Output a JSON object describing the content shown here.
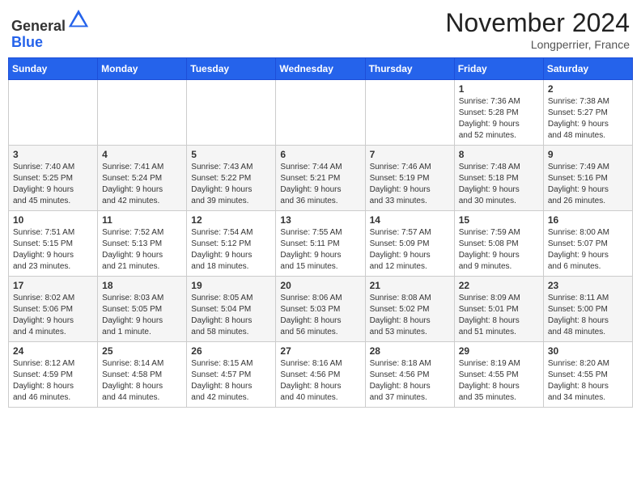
{
  "header": {
    "logo_line1": "General",
    "logo_line2": "Blue",
    "month_title": "November 2024",
    "location": "Longperrier, France"
  },
  "weekdays": [
    "Sunday",
    "Monday",
    "Tuesday",
    "Wednesday",
    "Thursday",
    "Friday",
    "Saturday"
  ],
  "weeks": [
    [
      {
        "day": "",
        "info": ""
      },
      {
        "day": "",
        "info": ""
      },
      {
        "day": "",
        "info": ""
      },
      {
        "day": "",
        "info": ""
      },
      {
        "day": "",
        "info": ""
      },
      {
        "day": "1",
        "info": "Sunrise: 7:36 AM\nSunset: 5:28 PM\nDaylight: 9 hours\nand 52 minutes."
      },
      {
        "day": "2",
        "info": "Sunrise: 7:38 AM\nSunset: 5:27 PM\nDaylight: 9 hours\nand 48 minutes."
      }
    ],
    [
      {
        "day": "3",
        "info": "Sunrise: 7:40 AM\nSunset: 5:25 PM\nDaylight: 9 hours\nand 45 minutes."
      },
      {
        "day": "4",
        "info": "Sunrise: 7:41 AM\nSunset: 5:24 PM\nDaylight: 9 hours\nand 42 minutes."
      },
      {
        "day": "5",
        "info": "Sunrise: 7:43 AM\nSunset: 5:22 PM\nDaylight: 9 hours\nand 39 minutes."
      },
      {
        "day": "6",
        "info": "Sunrise: 7:44 AM\nSunset: 5:21 PM\nDaylight: 9 hours\nand 36 minutes."
      },
      {
        "day": "7",
        "info": "Sunrise: 7:46 AM\nSunset: 5:19 PM\nDaylight: 9 hours\nand 33 minutes."
      },
      {
        "day": "8",
        "info": "Sunrise: 7:48 AM\nSunset: 5:18 PM\nDaylight: 9 hours\nand 30 minutes."
      },
      {
        "day": "9",
        "info": "Sunrise: 7:49 AM\nSunset: 5:16 PM\nDaylight: 9 hours\nand 26 minutes."
      }
    ],
    [
      {
        "day": "10",
        "info": "Sunrise: 7:51 AM\nSunset: 5:15 PM\nDaylight: 9 hours\nand 23 minutes."
      },
      {
        "day": "11",
        "info": "Sunrise: 7:52 AM\nSunset: 5:13 PM\nDaylight: 9 hours\nand 21 minutes."
      },
      {
        "day": "12",
        "info": "Sunrise: 7:54 AM\nSunset: 5:12 PM\nDaylight: 9 hours\nand 18 minutes."
      },
      {
        "day": "13",
        "info": "Sunrise: 7:55 AM\nSunset: 5:11 PM\nDaylight: 9 hours\nand 15 minutes."
      },
      {
        "day": "14",
        "info": "Sunrise: 7:57 AM\nSunset: 5:09 PM\nDaylight: 9 hours\nand 12 minutes."
      },
      {
        "day": "15",
        "info": "Sunrise: 7:59 AM\nSunset: 5:08 PM\nDaylight: 9 hours\nand 9 minutes."
      },
      {
        "day": "16",
        "info": "Sunrise: 8:00 AM\nSunset: 5:07 PM\nDaylight: 9 hours\nand 6 minutes."
      }
    ],
    [
      {
        "day": "17",
        "info": "Sunrise: 8:02 AM\nSunset: 5:06 PM\nDaylight: 9 hours\nand 4 minutes."
      },
      {
        "day": "18",
        "info": "Sunrise: 8:03 AM\nSunset: 5:05 PM\nDaylight: 9 hours\nand 1 minute."
      },
      {
        "day": "19",
        "info": "Sunrise: 8:05 AM\nSunset: 5:04 PM\nDaylight: 8 hours\nand 58 minutes."
      },
      {
        "day": "20",
        "info": "Sunrise: 8:06 AM\nSunset: 5:03 PM\nDaylight: 8 hours\nand 56 minutes."
      },
      {
        "day": "21",
        "info": "Sunrise: 8:08 AM\nSunset: 5:02 PM\nDaylight: 8 hours\nand 53 minutes."
      },
      {
        "day": "22",
        "info": "Sunrise: 8:09 AM\nSunset: 5:01 PM\nDaylight: 8 hours\nand 51 minutes."
      },
      {
        "day": "23",
        "info": "Sunrise: 8:11 AM\nSunset: 5:00 PM\nDaylight: 8 hours\nand 48 minutes."
      }
    ],
    [
      {
        "day": "24",
        "info": "Sunrise: 8:12 AM\nSunset: 4:59 PM\nDaylight: 8 hours\nand 46 minutes."
      },
      {
        "day": "25",
        "info": "Sunrise: 8:14 AM\nSunset: 4:58 PM\nDaylight: 8 hours\nand 44 minutes."
      },
      {
        "day": "26",
        "info": "Sunrise: 8:15 AM\nSunset: 4:57 PM\nDaylight: 8 hours\nand 42 minutes."
      },
      {
        "day": "27",
        "info": "Sunrise: 8:16 AM\nSunset: 4:56 PM\nDaylight: 8 hours\nand 40 minutes."
      },
      {
        "day": "28",
        "info": "Sunrise: 8:18 AM\nSunset: 4:56 PM\nDaylight: 8 hours\nand 37 minutes."
      },
      {
        "day": "29",
        "info": "Sunrise: 8:19 AM\nSunset: 4:55 PM\nDaylight: 8 hours\nand 35 minutes."
      },
      {
        "day": "30",
        "info": "Sunrise: 8:20 AM\nSunset: 4:55 PM\nDaylight: 8 hours\nand 34 minutes."
      }
    ]
  ]
}
